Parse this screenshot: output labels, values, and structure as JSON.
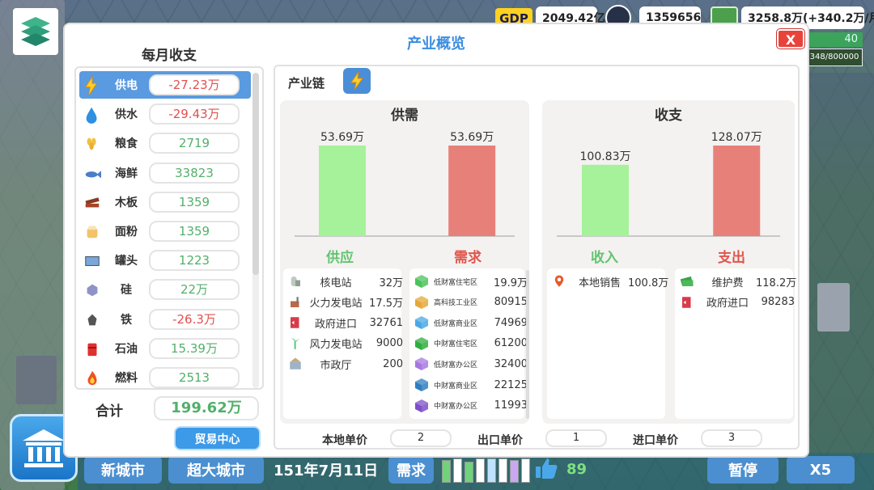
{
  "hud": {
    "gdp_tag": "GDP",
    "gdp_value": "2049.42亿",
    "population": "1359656",
    "money": "3258.8万(+340.2万/月)",
    "side_value": "40",
    "progress_text": "348/800000",
    "progress_fraction": 0.0004
  },
  "modal": {
    "title": "产业概览",
    "close_label": "X"
  },
  "monthly": {
    "title": "每月收支",
    "items": [
      {
        "name": "供电",
        "value": "-27.23万",
        "negative": true,
        "icon": "lightning-icon",
        "selected": true
      },
      {
        "name": "供水",
        "value": "-29.43万",
        "negative": true,
        "icon": "water-drop-icon"
      },
      {
        "name": "粮食",
        "value": "2719",
        "negative": false,
        "icon": "wheat-icon"
      },
      {
        "name": "海鲜",
        "value": "33823",
        "negative": false,
        "icon": "fish-icon"
      },
      {
        "name": "木板",
        "value": "1359",
        "negative": false,
        "icon": "wood-plank-icon"
      },
      {
        "name": "面粉",
        "value": "1359",
        "negative": false,
        "icon": "flour-icon"
      },
      {
        "name": "罐头",
        "value": "1223",
        "negative": false,
        "icon": "can-icon"
      },
      {
        "name": "硅",
        "value": "22万",
        "negative": false,
        "icon": "silicon-icon"
      },
      {
        "name": "铁",
        "value": "-26.3万",
        "negative": true,
        "icon": "iron-icon"
      },
      {
        "name": "石油",
        "value": "15.39万",
        "negative": false,
        "icon": "oil-barrel-icon"
      },
      {
        "name": "燃料",
        "value": "2513",
        "negative": false,
        "icon": "fuel-flame-icon"
      }
    ],
    "total_label": "合计",
    "total_value": "199.62万",
    "trade_button": "贸易中心"
  },
  "chain": {
    "label": "产业链",
    "icon": "lightning-icon"
  },
  "supply_demand": {
    "title": "供需",
    "supply_label": "供应",
    "demand_label": "需求",
    "supply_items": [
      {
        "name": "核电站",
        "value": "32万",
        "icon": "nuclear-plant-icon"
      },
      {
        "name": "火力发电站",
        "value": "17.5万",
        "icon": "thermal-plant-icon"
      },
      {
        "name": "政府进口",
        "value": "32761",
        "icon": "government-import-icon"
      },
      {
        "name": "风力发电站",
        "value": "9000",
        "icon": "wind-plant-icon"
      },
      {
        "name": "市政厅",
        "value": "200",
        "icon": "city-hall-icon"
      }
    ],
    "demand_items": [
      {
        "name": "低财富住宅区",
        "value": "19.9万",
        "color": "#4cc35a"
      },
      {
        "name": "高科技工业区",
        "value": "80915",
        "color": "#e6a83a"
      },
      {
        "name": "低财富商业区",
        "value": "74969",
        "color": "#4aa8e8"
      },
      {
        "name": "中财富住宅区",
        "value": "61200",
        "color": "#2fae3f"
      },
      {
        "name": "低财富办公区",
        "value": "32400",
        "color": "#a779e0"
      },
      {
        "name": "中财富商业区",
        "value": "22125",
        "color": "#2f7fc0"
      },
      {
        "name": "中财富办公区",
        "value": "11993",
        "color": "#7d4fc7"
      }
    ]
  },
  "income_expense": {
    "title": "收支",
    "income_label": "收入",
    "expense_label": "支出",
    "income_items": [
      {
        "name": "本地销售",
        "value": "100.8万",
        "icon": "map-pin-icon"
      }
    ],
    "expense_items": [
      {
        "name": "维护费",
        "value": "118.2万",
        "icon": "money-stack-icon"
      },
      {
        "name": "政府进口",
        "value": "98283",
        "icon": "government-import-icon"
      }
    ]
  },
  "chart_data": [
    {
      "type": "bar",
      "title": "供需",
      "categories": [
        "供应",
        "需求"
      ],
      "values": [
        53.69,
        53.69
      ],
      "value_labels": [
        "53.69万",
        "53.69万"
      ],
      "unit": "万",
      "colors": [
        "#a6f29a",
        "#e8807a"
      ],
      "ylim": [
        0,
        53.69
      ]
    },
    {
      "type": "bar",
      "title": "收支",
      "categories": [
        "收入",
        "支出"
      ],
      "values": [
        100.83,
        128.07
      ],
      "value_labels": [
        "100.83万",
        "128.07万"
      ],
      "unit": "万",
      "colors": [
        "#a6f29a",
        "#e8807a"
      ],
      "ylim": [
        0,
        128.07
      ]
    }
  ],
  "prices": {
    "local_label": "本地单价",
    "local_value": "2",
    "export_label": "出口单价",
    "export_value": "1",
    "import_label": "进口单价",
    "import_value": "3"
  },
  "bottom": {
    "new_city": "新城市",
    "mega_city": "超大城市",
    "date": "151年7月11日",
    "demand": "需求",
    "score": "89",
    "pause": "暂停",
    "speed": "X5"
  },
  "colors": {
    "accent": "#3a8de0",
    "positive": "#52b06a",
    "negative": "#e25050",
    "supply_bar": "#a6f29a",
    "demand_bar": "#e8807a"
  }
}
